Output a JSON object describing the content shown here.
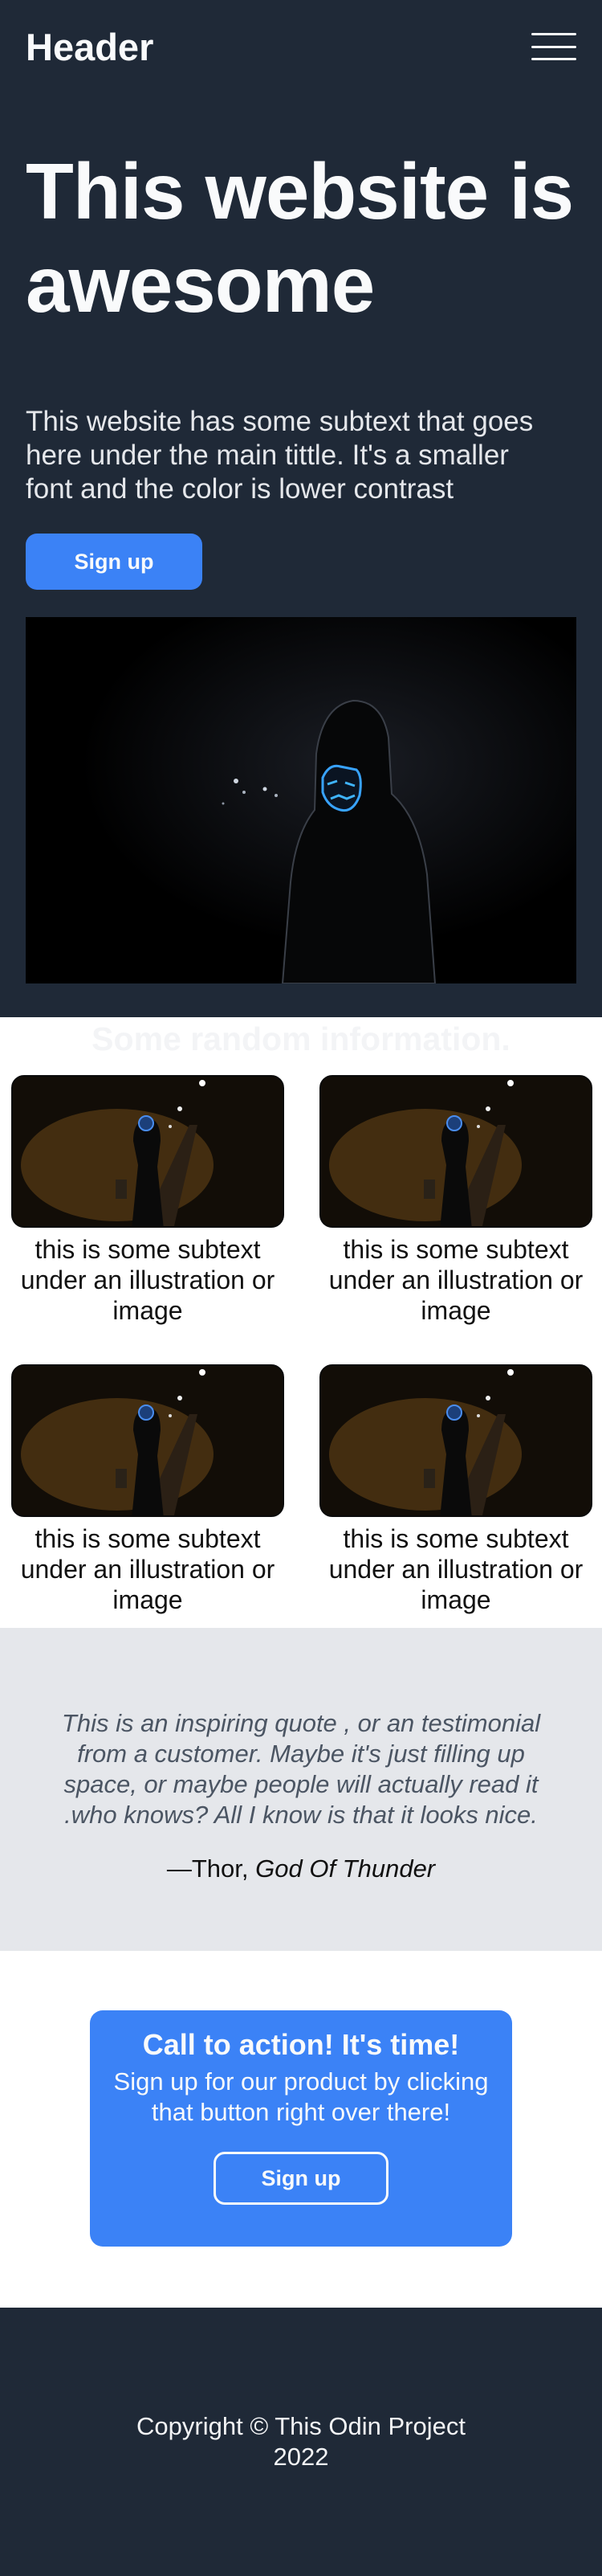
{
  "header": {
    "logo": "Header",
    "menu_icon": "hamburger-menu-icon"
  },
  "hero": {
    "title": "This website is awesome",
    "subtitle": "This website has some subtext that goes here under the main tittle. It's a smaller font and the color is lower contrast",
    "signup_label": "Sign up",
    "bg_color": "#1f2937",
    "accent_color": "#3b82f6"
  },
  "info": {
    "title": "Some random information.",
    "cards": [
      {
        "caption": "this is some subtext under an illustration or image"
      },
      {
        "caption": "this is some subtext under an illustration or image"
      },
      {
        "caption": "this is some subtext under an illustration or image"
      },
      {
        "caption": "this is some subtext under an illustration or image"
      }
    ]
  },
  "quote": {
    "text": "This is an inspiring quote , or an testimonial from a customer. Maybe it's just filling up space, or maybe people will actually read it .who knows? All I know is that it looks nice.",
    "author": "—Thor, ",
    "author_title": "God Of Thunder"
  },
  "cta": {
    "title": "Call to action! It's time!",
    "text": "Sign up for our product by clicking that button right over there!",
    "button_label": "Sign up"
  },
  "footer": {
    "copyright": "Copyright © This Odin Project 2022"
  }
}
